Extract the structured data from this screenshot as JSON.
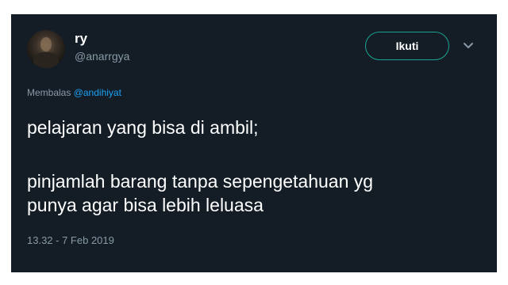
{
  "tweet": {
    "display_name": "ry",
    "handle": "@anarrgya",
    "follow_label": "Ikuti",
    "reply_prefix": "Membalas",
    "reply_to": "@andihiyat",
    "text_line_1": "pelajaran yang bisa di ambil;",
    "text_line_2": "pinjamlah barang tanpa sepengetahuan yg",
    "text_line_3": "punya agar bisa lebih leluasa",
    "timestamp": "13.32 - 7 Feb 2019"
  },
  "icons": {
    "avatar": "user-photo",
    "menu": "chevron-down-icon"
  },
  "colors": {
    "background": "#141d26",
    "text": "#ffffff",
    "secondary_text": "#8899a6",
    "link": "#1da1f2",
    "follow_border": "#1aa38f"
  }
}
